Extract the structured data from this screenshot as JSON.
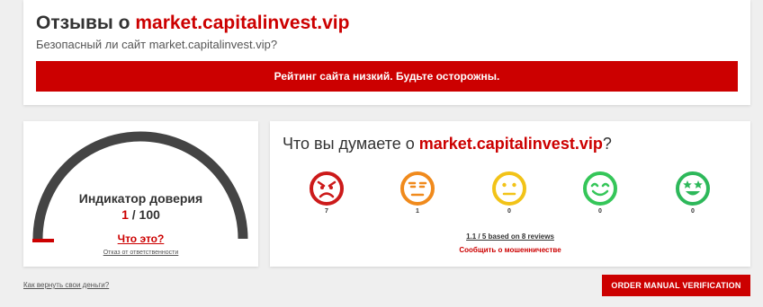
{
  "header": {
    "title_prefix": "Отзывы о",
    "domain": "market.capitalinvest.vip",
    "subtitle": "Безопасный ли сайт market.capitalinvest.vip?",
    "warning_banner": "Рейтинг сайта низкий. Будьте осторожны."
  },
  "trust": {
    "label": "Индикатор доверия",
    "score": "1",
    "max": "/ 100",
    "score_fraction": 0.01,
    "what_link": "Что это?",
    "disclaimer": "Отказ от ответственности"
  },
  "opinion": {
    "title_prefix": "Что вы думаете о",
    "domain": "market.capitalinvest.vip",
    "title_suffix": "?",
    "faces": [
      {
        "icon": "angry-face-icon",
        "color": "#cc1a1a",
        "count": "7"
      },
      {
        "icon": "expressionless-face-icon",
        "color": "#f08a1c",
        "count": "1"
      },
      {
        "icon": "neutral-face-icon",
        "color": "#f2c318",
        "count": "0"
      },
      {
        "icon": "smiling-face-icon",
        "color": "#35c659",
        "count": "0"
      },
      {
        "icon": "star-eyes-face-icon",
        "color": "#2db85a",
        "count": "0"
      }
    ],
    "summary": "1.1 / 5 based on 8 reviews",
    "report_link": "Сообщить о мошенничестве"
  },
  "footer": {
    "money_link": "Как вернуть свои деньги?",
    "order_button": "ORDER MANUAL VERIFICATION"
  },
  "colors": {
    "accent": "#cc0000",
    "gauge_track": "#444444",
    "background": "#efefef"
  }
}
